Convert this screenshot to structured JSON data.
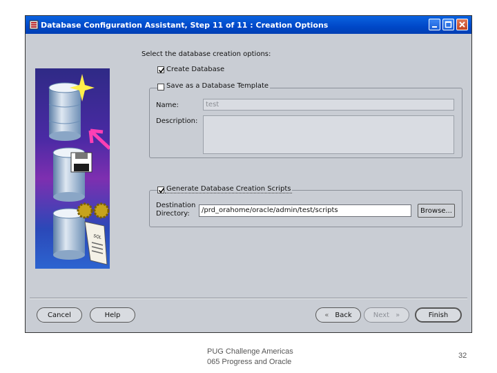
{
  "window": {
    "title": "Database Configuration Assistant, Step 11 of 11 : Creation Options"
  },
  "form": {
    "prompt": "Select the database creation options:",
    "create_database": {
      "label": "Create Database",
      "checked": true
    },
    "save_template": {
      "label": "Save as a Database Template",
      "checked": false,
      "name_label": "Name:",
      "name_value": "test",
      "description_label": "Description:",
      "description_value": ""
    },
    "generate_scripts": {
      "label": "Generate Database Creation Scripts",
      "checked": true,
      "destination_label_line1": "Destination",
      "destination_label_line2": "Directory:",
      "destination_value": "/prd_orahome/oracle/admin/test/scripts",
      "browse_label": "Browse..."
    }
  },
  "buttons": {
    "cancel": "Cancel",
    "help": "Help",
    "back": "Back",
    "next": "Next",
    "finish": "Finish"
  },
  "art": {
    "icons": [
      "database-sparkle-icon",
      "database-floppy-icon",
      "database-sql-gears-icon"
    ],
    "sql_label": "SQL"
  },
  "slide": {
    "footer_line1": "PUG Challenge Americas",
    "footer_line2": "065 Progress and Oracle",
    "page_number": "32"
  }
}
